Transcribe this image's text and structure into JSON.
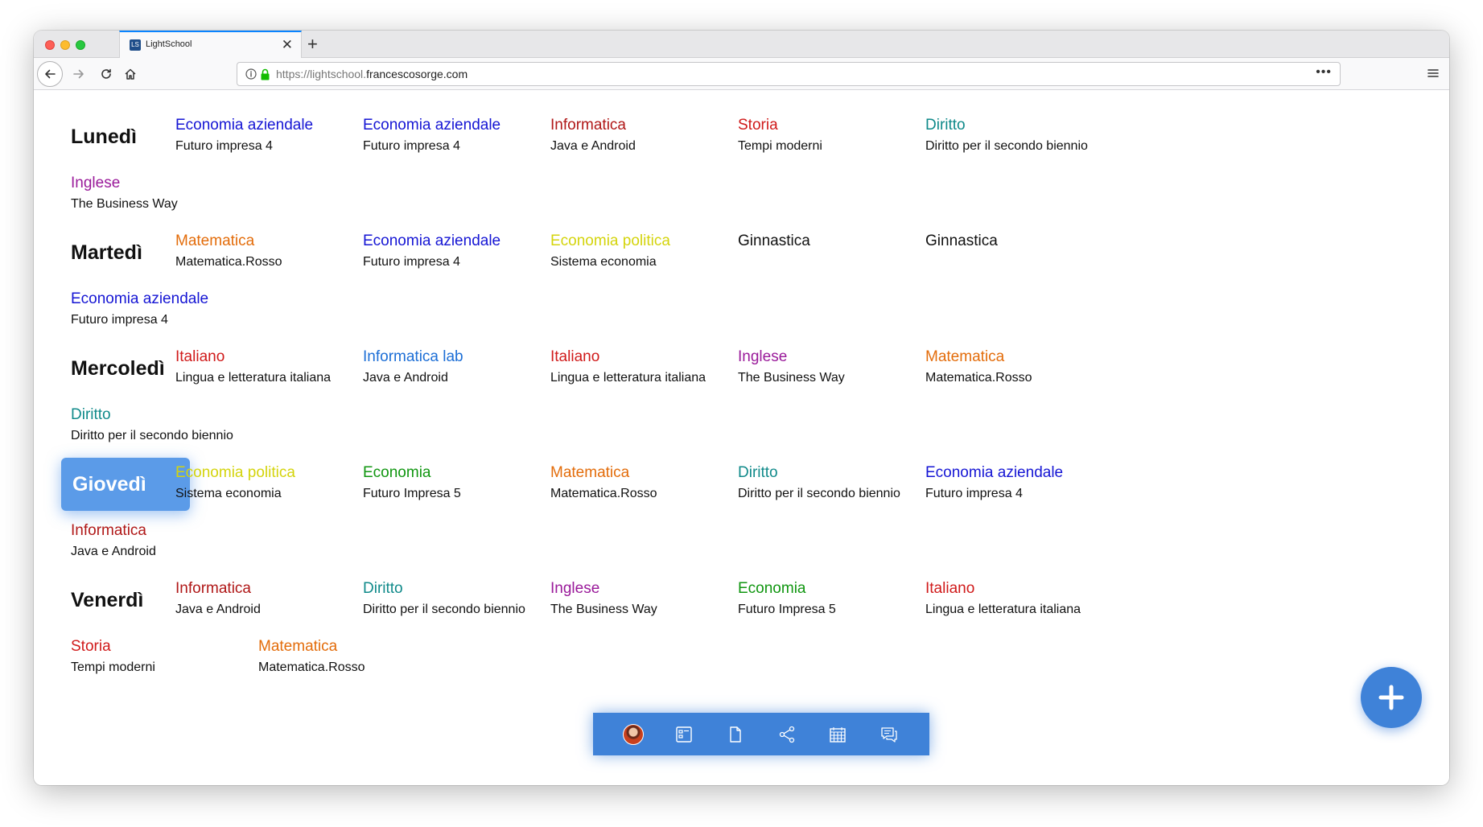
{
  "browser": {
    "tab_title": "LightSchool",
    "favicon_text": "LS",
    "url_prefix": "https://lightschool.",
    "url_domain": "francescosorge.com",
    "more_label": "•••"
  },
  "timetable": [
    {
      "day": "Lunedì",
      "active": false,
      "lessons": [
        {
          "subject": "Economia aziendale",
          "book": "Futuro impresa 4",
          "color": "#1515d4"
        },
        {
          "subject": "Economia aziendale",
          "book": "Futuro impresa 4",
          "color": "#1515d4"
        },
        {
          "subject": "Informatica",
          "book": "Java e Android",
          "color": "#b01818"
        },
        {
          "subject": "Storia",
          "book": "Tempi moderni",
          "color": "#d01a1a"
        },
        {
          "subject": "Diritto",
          "book": "Diritto per il secondo biennio",
          "color": "#108a8a"
        },
        {
          "subject": "Inglese",
          "book": "The Business Way",
          "color": "#9a1a9a"
        }
      ]
    },
    {
      "day": "Martedì",
      "active": false,
      "lessons": [
        {
          "subject": "Matematica",
          "book": "Matematica.Rosso",
          "color": "#e36c0a"
        },
        {
          "subject": "Economia aziendale",
          "book": "Futuro impresa 4",
          "color": "#1515d4"
        },
        {
          "subject": "Economia politica",
          "book": "Sistema economia",
          "color": "#d4d40c"
        },
        {
          "subject": "Ginnastica",
          "book": "",
          "color": "#111111"
        },
        {
          "subject": "Ginnastica",
          "book": "",
          "color": "#111111"
        },
        {
          "subject": "Economia aziendale",
          "book": "Futuro impresa 4",
          "color": "#1515d4"
        }
      ]
    },
    {
      "day": "Mercoledì",
      "active": false,
      "lessons": [
        {
          "subject": "Italiano",
          "book": "Lingua e letteratura italiana",
          "color": "#d01a1a"
        },
        {
          "subject": "Informatica lab",
          "book": "Java e Android",
          "color": "#1c6ed6"
        },
        {
          "subject": "Italiano",
          "book": "Lingua e letteratura italiana",
          "color": "#d01a1a"
        },
        {
          "subject": "Inglese",
          "book": "The Business Way",
          "color": "#9a1a9a"
        },
        {
          "subject": "Matematica",
          "book": "Matematica.Rosso",
          "color": "#e36c0a"
        },
        {
          "subject": "Diritto",
          "book": "Diritto per il secondo biennio",
          "color": "#108a8a"
        }
      ]
    },
    {
      "day": "Giovedì",
      "active": true,
      "lessons": [
        {
          "subject": "Economia politica",
          "book": "Sistema economia",
          "color": "#d4d40c"
        },
        {
          "subject": "Economia",
          "book": "Futuro Impresa 5",
          "color": "#109610"
        },
        {
          "subject": "Matematica",
          "book": "Matematica.Rosso",
          "color": "#e36c0a"
        },
        {
          "subject": "Diritto",
          "book": "Diritto per il secondo biennio",
          "color": "#108a8a"
        },
        {
          "subject": "Economia aziendale",
          "book": "Futuro impresa 4",
          "color": "#1515d4"
        },
        {
          "subject": "Informatica",
          "book": "Java e Android",
          "color": "#b01818"
        }
      ]
    },
    {
      "day": "Venerdì",
      "active": false,
      "lessons": [
        {
          "subject": "Informatica",
          "book": "Java e Android",
          "color": "#b01818"
        },
        {
          "subject": "Diritto",
          "book": "Diritto per il secondo biennio",
          "color": "#108a8a"
        },
        {
          "subject": "Inglese",
          "book": "The Business Way",
          "color": "#9a1a9a"
        },
        {
          "subject": "Economia",
          "book": "Futuro Impresa 5",
          "color": "#109610"
        },
        {
          "subject": "Italiano",
          "book": "Lingua e letteratura italiana",
          "color": "#d01a1a"
        },
        {
          "subject": "Storia",
          "book": "Tempi moderni",
          "color": "#d01a1a"
        },
        {
          "subject": "Matematica",
          "book": "Matematica.Rosso",
          "color": "#e36c0a"
        }
      ]
    }
  ],
  "dock": {
    "items": [
      "avatar",
      "desktop-icon",
      "file-icon",
      "share-icon",
      "calendar-icon",
      "chat-icon"
    ]
  },
  "fab": {
    "icon": "plus-icon",
    "color": "#3f82d8"
  }
}
